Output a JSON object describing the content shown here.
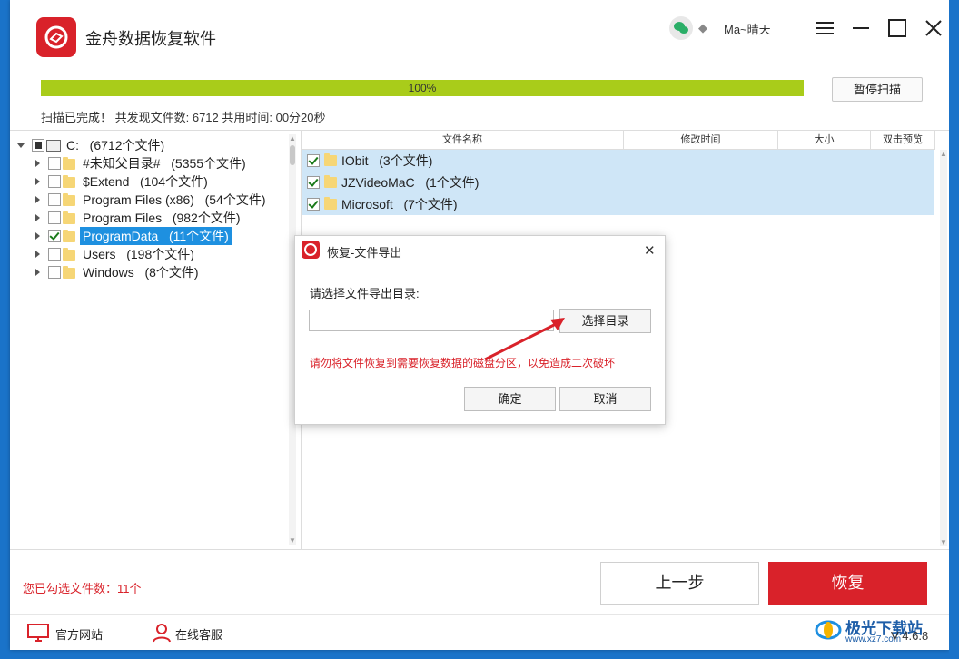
{
  "window": {
    "title": "金舟数据恢复软件",
    "username": "Ma~晴天"
  },
  "scan": {
    "progress_percent": 100,
    "progress_text": "100%",
    "pause_label": "暂停扫描",
    "status_text": "扫描已完成！ 共发现文件数: 6712  共用时间: 00分20秒"
  },
  "tree": {
    "root": {
      "name": "C:",
      "count": "(6712个文件)"
    },
    "items": [
      {
        "name": "#未知父目录#",
        "count": "(5355个文件)",
        "checked": false
      },
      {
        "name": "$Extend",
        "count": "(104个文件)",
        "checked": false
      },
      {
        "name": "Program Files (x86)",
        "count": "(54个文件)",
        "checked": false
      },
      {
        "name": "Program Files",
        "count": "(982个文件)",
        "checked": false
      },
      {
        "name": "ProgramData",
        "count": "(11个文件)",
        "checked": true
      },
      {
        "name": "Users",
        "count": "(198个文件)",
        "checked": false
      },
      {
        "name": "Windows",
        "count": "(8个文件)",
        "checked": false
      }
    ]
  },
  "file_list": {
    "columns": [
      "文件名称",
      "修改时间",
      "大小",
      "双击预览"
    ],
    "rows": [
      {
        "name": "IObit",
        "count": "(3个文件)"
      },
      {
        "name": "JZVideoMaC",
        "count": "(1个文件)"
      },
      {
        "name": "Microsoft",
        "count": "(7个文件)"
      }
    ]
  },
  "footer": {
    "selected_text": "您已勾选文件数：11个",
    "prev_label": "上一步",
    "recover_label": "恢复",
    "official_site": "官方网站",
    "online_service": "在线客服",
    "version": "V 4.6.8"
  },
  "dialog": {
    "title": "恢复-文件导出",
    "prompt": "请选择文件导出目录:",
    "path_value": "",
    "browse_label": "选择目录",
    "warning": "请勿将文件恢复到需要恢复数据的磁盘分区，以免造成二次破坏",
    "ok_label": "确定",
    "cancel_label": "取消"
  },
  "watermark": {
    "brand": "极光下载站",
    "url": "www.xz7.com"
  },
  "colors": {
    "brand_red": "#d9222a",
    "progress_green": "#a9cc1a",
    "selection_blue": "#1e90e0",
    "row_highlight": "#cfe6f7",
    "desktop_blue": "#1a73c9"
  }
}
